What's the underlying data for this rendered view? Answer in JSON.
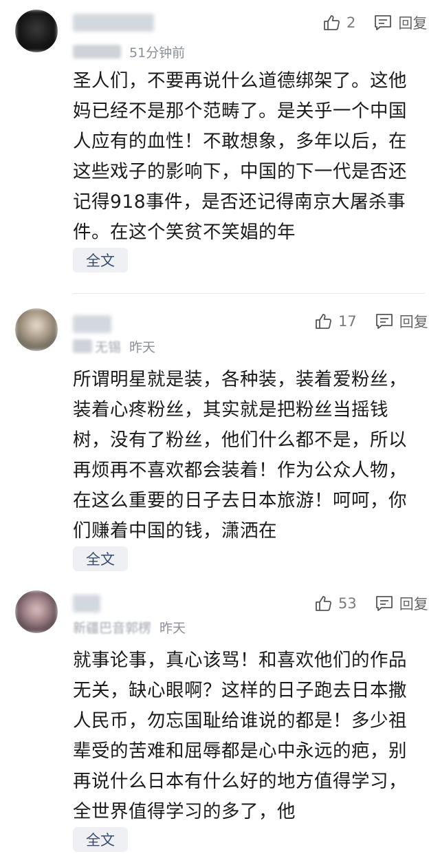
{
  "comments": [
    {
      "likes": "2",
      "reply_label": "回复",
      "time": "51分钟前",
      "location": "",
      "text": "圣人们，不要再说什么道德绑架了。这他妈已经不是那个范畴了。是关乎一个中国人应有的血性！不敢想象，多年以后，在这些戏子的影响下，中国的下一代是否还记得918事件，是否还记得南京大屠杀事件。在这个笑贫不笑娼的年",
      "fulltext_label": "全文"
    },
    {
      "likes": "17",
      "reply_label": "回复",
      "time": "昨天",
      "location": "无锡",
      "text": "所谓明星就是装，各种装，装着爱粉丝，装着心疼粉丝，其实就是把粉丝当摇钱树，没有了粉丝，他们什么都不是，所以再烦再不喜欢都会装着！作为公众人物，在这么重要的日子去日本旅游！呵呵，你们赚着中国的钱，潇洒在",
      "fulltext_label": "全文"
    },
    {
      "likes": "53",
      "reply_label": "回复",
      "time": "昨天",
      "location": "新疆巴音郭楞",
      "text": "就事论事，真心该骂！和喜欢他们的作品无关，缺心眼啊？这样的日子跑去日本撒人民币，勿忘国耻给谁说的都是！多少祖辈受的苦难和屈辱都是心中永远的疤，别再说什么日本有什么好的地方值得学习，全世界值得学习的多了，他",
      "fulltext_label": "全文"
    }
  ],
  "icons": {
    "like": "thumbs-up-icon",
    "reply": "comment-reply-icon"
  },
  "colors": {
    "text": "#1b1b1b",
    "meta": "#8a8e95",
    "button_bg": "#eef0f3"
  }
}
